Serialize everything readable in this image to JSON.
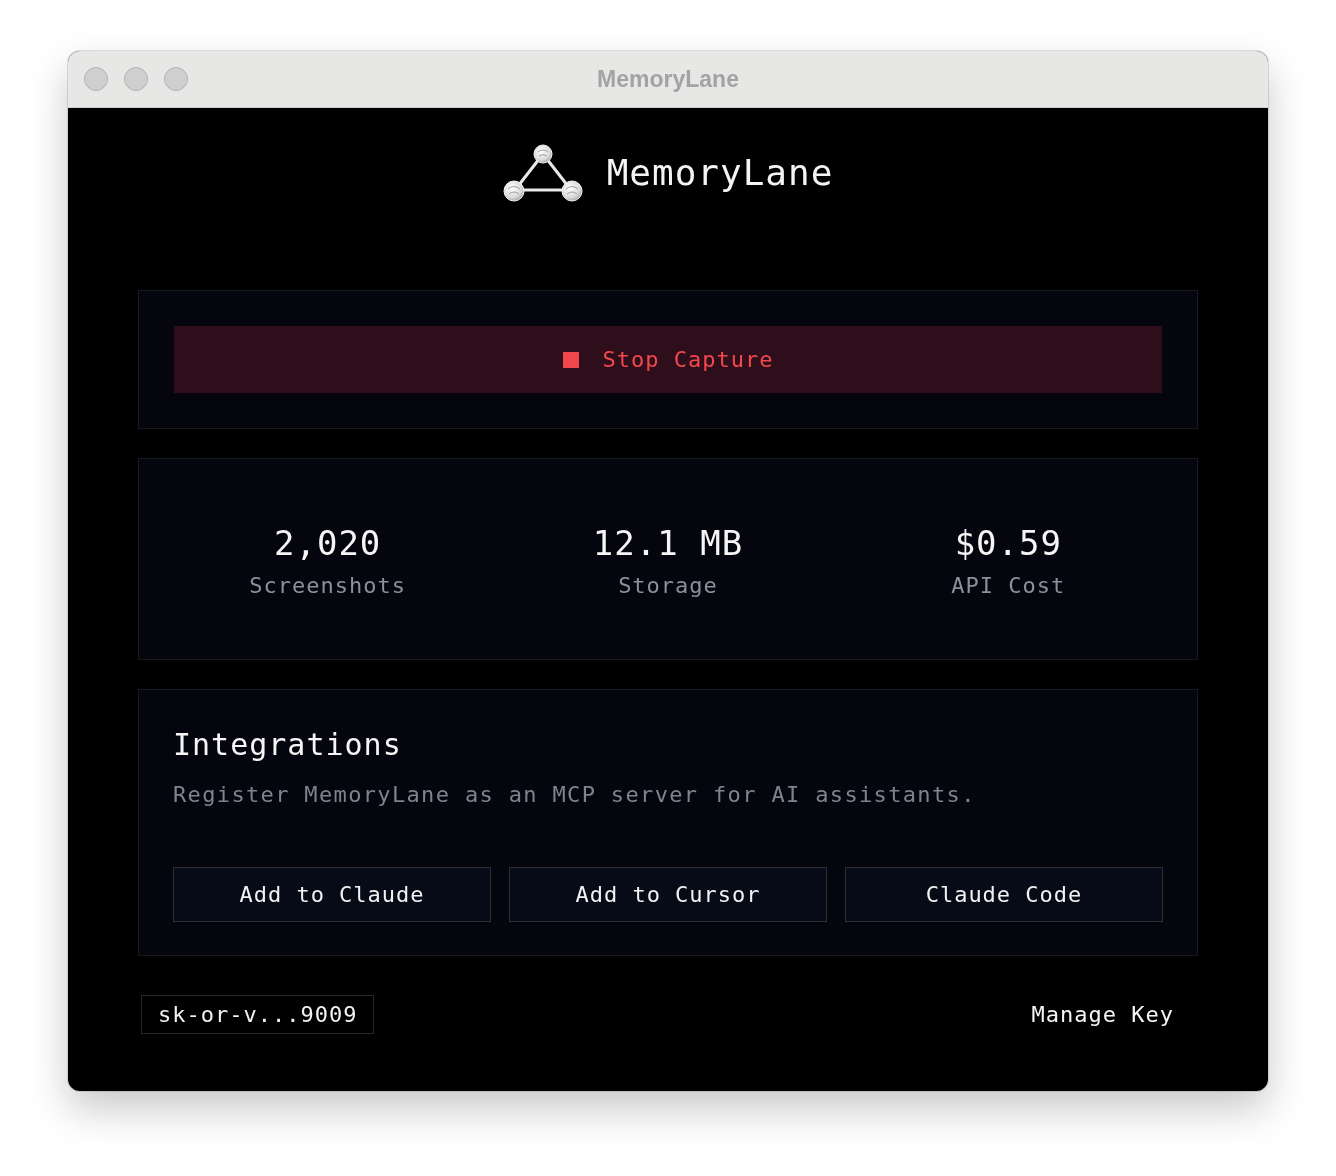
{
  "window": {
    "title": "MemoryLane"
  },
  "header": {
    "title": "MemoryLane"
  },
  "capture": {
    "label": "Stop Capture",
    "recording": true
  },
  "stats": [
    {
      "value": "2,020",
      "label": "Screenshots"
    },
    {
      "value": "12.1 MB",
      "label": "Storage"
    },
    {
      "value": "$0.59",
      "label": "API Cost"
    }
  ],
  "integrations": {
    "title": "Integrations",
    "description": "Register MemoryLane as an MCP server for AI assistants.",
    "buttons": [
      "Add to Claude",
      "Add to Cursor",
      "Claude Code"
    ]
  },
  "footer": {
    "api_key": "sk-or-v...9009",
    "manage_button": "Manage Key"
  }
}
